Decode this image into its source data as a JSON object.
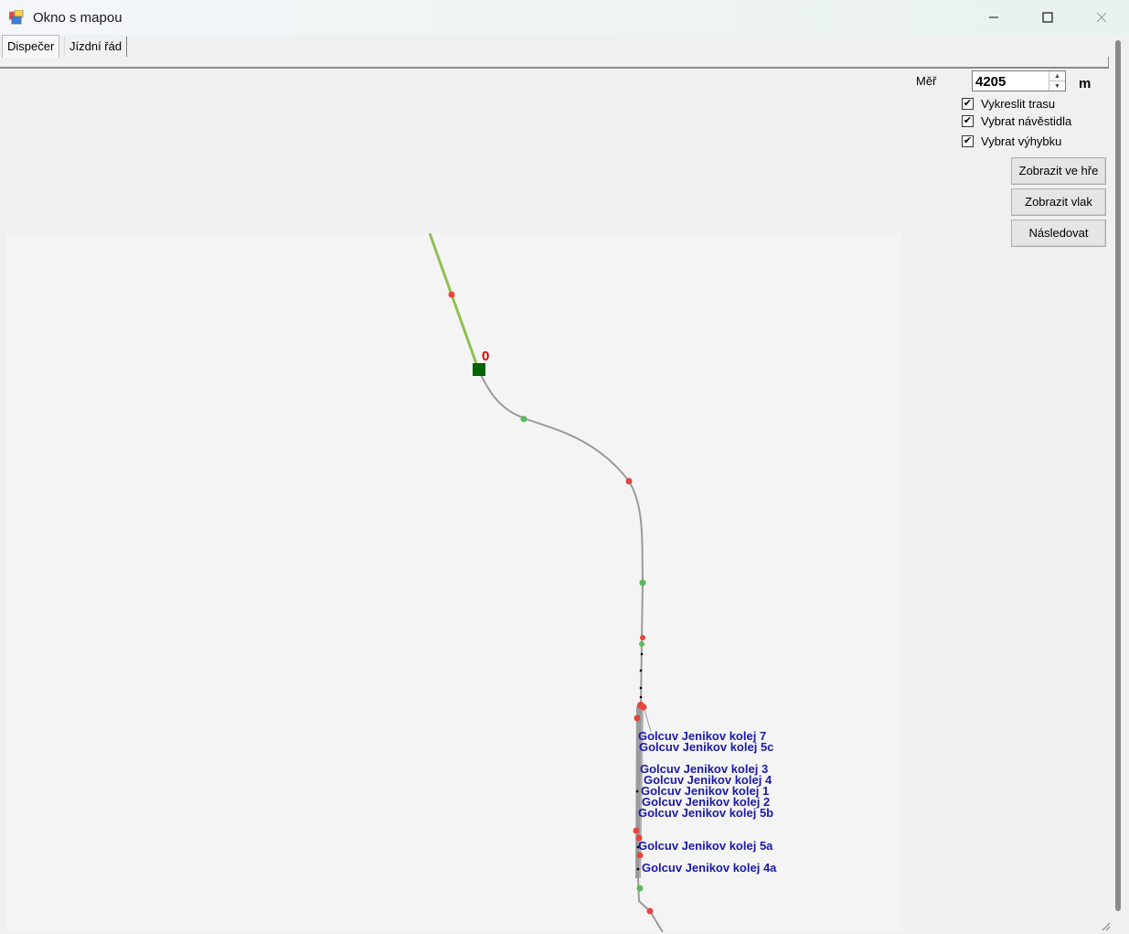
{
  "window": {
    "title": "Okno s mapou",
    "icon": "app-window-icon"
  },
  "tabs": [
    {
      "label": "Dispečer",
      "active": true
    },
    {
      "label": "Jízdní řád",
      "active": false
    }
  ],
  "controls": {
    "scale_label": "Měř",
    "scale_value": "4205",
    "scale_unit": "m",
    "checkboxes": [
      {
        "label": "Vykreslit trasu",
        "checked": true
      },
      {
        "label": "Vybrat návěstidla",
        "checked": true
      },
      {
        "label": "Vybrat výhybku",
        "checked": true
      }
    ],
    "buttons": [
      {
        "label": "Zobrazit ve hře"
      },
      {
        "label": "Zobrazit vlak"
      },
      {
        "label": "Následovat"
      }
    ]
  },
  "map": {
    "train_number": "0",
    "colors": {
      "route": "#8fc050",
      "track": "#9a9a9a",
      "signal_red": "#e8443a",
      "signal_green": "#5cb85c",
      "train": "#006400",
      "label": "#1a1aa8",
      "train_number": "#e00000"
    },
    "station_labels": [
      "Golcuv Jenikov kolej 7",
      "Golcuv Jenikov kolej 5c",
      "Golcuv Jenikov kolej 3",
      "Golcuv Jenikov kolej 4",
      "Golcuv Jenikov kolej 1",
      "Golcuv Jenikov kolej 2",
      "Golcuv Jenikov kolej 5b",
      "Golcuv Jenikov kolej 5a",
      "Golcuv Jenikov kolej 4a"
    ]
  }
}
